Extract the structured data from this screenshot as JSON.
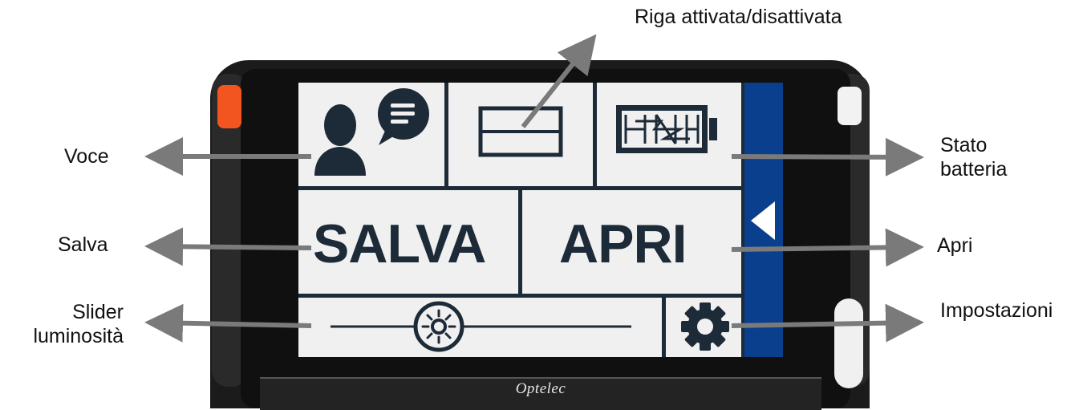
{
  "device": {
    "brand": "Optelec"
  },
  "screen": {
    "buttons": {
      "salva": "SALVA",
      "apri": "APRI"
    },
    "colors": {
      "panel_blue": "#0a3f8d",
      "icon_dark": "#1d2a37",
      "screen_bg": "#f0f0f0",
      "power_button": "#f2551f"
    },
    "icons": [
      "voice-icon",
      "reading-line-icon",
      "battery-icon",
      "brightness-icon",
      "gear-icon",
      "back-arrow-icon"
    ]
  },
  "callouts": {
    "riga": "Riga attivata/disattivata",
    "voce": "Voce",
    "stato_line1": "Stato",
    "stato_line2": "batteria",
    "salva": "Salva",
    "apri": "Apri",
    "slider_line1": "Slider",
    "slider_line2": "luminosità",
    "impostazioni": "Impostazioni"
  }
}
